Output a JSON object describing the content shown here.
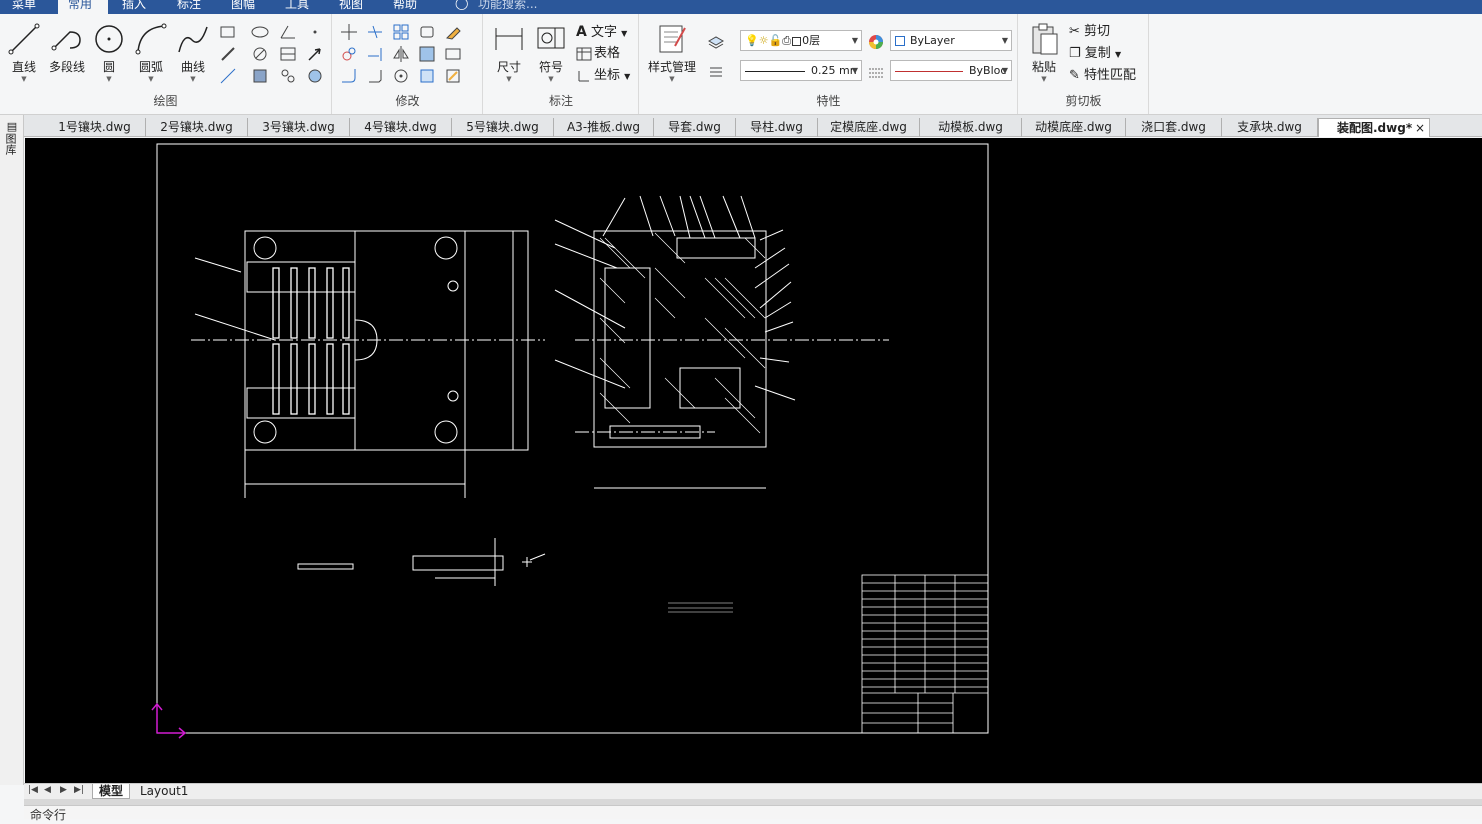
{
  "menubar": {
    "items": [
      "菜单",
      "常用",
      "插入",
      "标注",
      "图幅",
      "工具",
      "视图",
      "帮助"
    ],
    "active_index": 1,
    "search_placeholder": "功能搜索..."
  },
  "ribbon": {
    "groups": {
      "draw": {
        "label": "绘图",
        "buttons": [
          "直线",
          "多段线",
          "圆",
          "圆弧",
          "曲线"
        ]
      },
      "modify": {
        "label": "修改"
      },
      "annotate": {
        "label": "标注",
        "buttons": [
          "尺寸",
          "符号"
        ],
        "rows": [
          "文字",
          "表格",
          "坐标"
        ]
      },
      "properties": {
        "label": "特性",
        "style_button": "样式管理",
        "layer": "0层",
        "color": "ByLayer",
        "lineweight": "0.25 mn",
        "linetype": "ByBloc"
      },
      "clipboard": {
        "label": "剪切板",
        "paste": "粘贴",
        "rows": [
          "剪切",
          "复制",
          "特性匹配"
        ]
      }
    }
  },
  "document_tabs": {
    "items": [
      "1号镶块.dwg",
      "2号镶块.dwg",
      "3号镶块.dwg",
      "4号镶块.dwg",
      "5号镶块.dwg",
      "A3-推板.dwg",
      "导套.dwg",
      "导柱.dwg",
      "定模底座.dwg",
      "动模板.dwg",
      "动模底座.dwg",
      "浇口套.dwg",
      "支承块.dwg",
      "装配图.dwg*"
    ],
    "active_index": 13
  },
  "left_panel": {
    "label": "图库"
  },
  "layout_tabs": {
    "items": [
      "模型",
      "Layout1"
    ],
    "active_index": 0
  },
  "command_line": {
    "label": "命令行"
  },
  "colors": {
    "menubar": "#2b579a",
    "canvas": "#000000",
    "drawing_lines": "#ffffff",
    "ucs_icon": "#d21cd2"
  }
}
